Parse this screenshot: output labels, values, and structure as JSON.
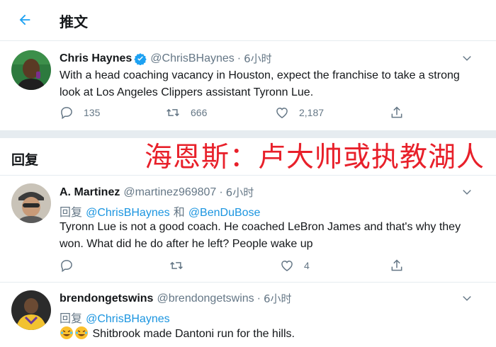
{
  "header": {
    "back_icon": "arrow-left-icon",
    "title": "推文"
  },
  "main_tweet": {
    "author_name": "Chris Haynes",
    "verified": true,
    "handle": "@ChrisBHaynes",
    "separator": "·",
    "time": "6小时",
    "text": "With a head coaching vacancy in Houston, expect the franchise to take a strong look at Los Angeles Clippers assistant Tyronn Lue.",
    "replies": "135",
    "retweets": "666",
    "likes": "2,187"
  },
  "replies_section": {
    "heading": "回复"
  },
  "overlay_caption": "海恩斯：卢大帅或执教湖人",
  "replies": [
    {
      "author_name": "A. Martinez",
      "handle": "@martinez969807",
      "separator": "·",
      "time": "6小时",
      "reply_prefix": "回复",
      "reply_to_1": "@ChrisBHaynes",
      "reply_conjunction": "和",
      "reply_to_2": "@BenDuBose",
      "text": "Tyronn Lue is not a good coach. He coached LeBron James and that's why they won. What did he do after he left?  People wake up",
      "replies": "",
      "retweets": "",
      "likes": "4"
    },
    {
      "author_name": "brendongetswins",
      "handle": "@brendongetswins",
      "separator": "·",
      "time": "6小时",
      "reply_prefix": "回复",
      "reply_to_1": "@ChrisBHaynes",
      "emoji": [
        "rolling-on-floor-laughing-emoji",
        "rolling-on-floor-laughing-emoji"
      ],
      "text": "Shitbrook made Dantoni run for the hills."
    }
  ],
  "colors": {
    "link_blue": "#1b95e0",
    "verified_blue": "#1da1f2",
    "muted_gray": "#657786",
    "separator_gray": "#e6ecf0",
    "caption_red": "#e8202a"
  }
}
